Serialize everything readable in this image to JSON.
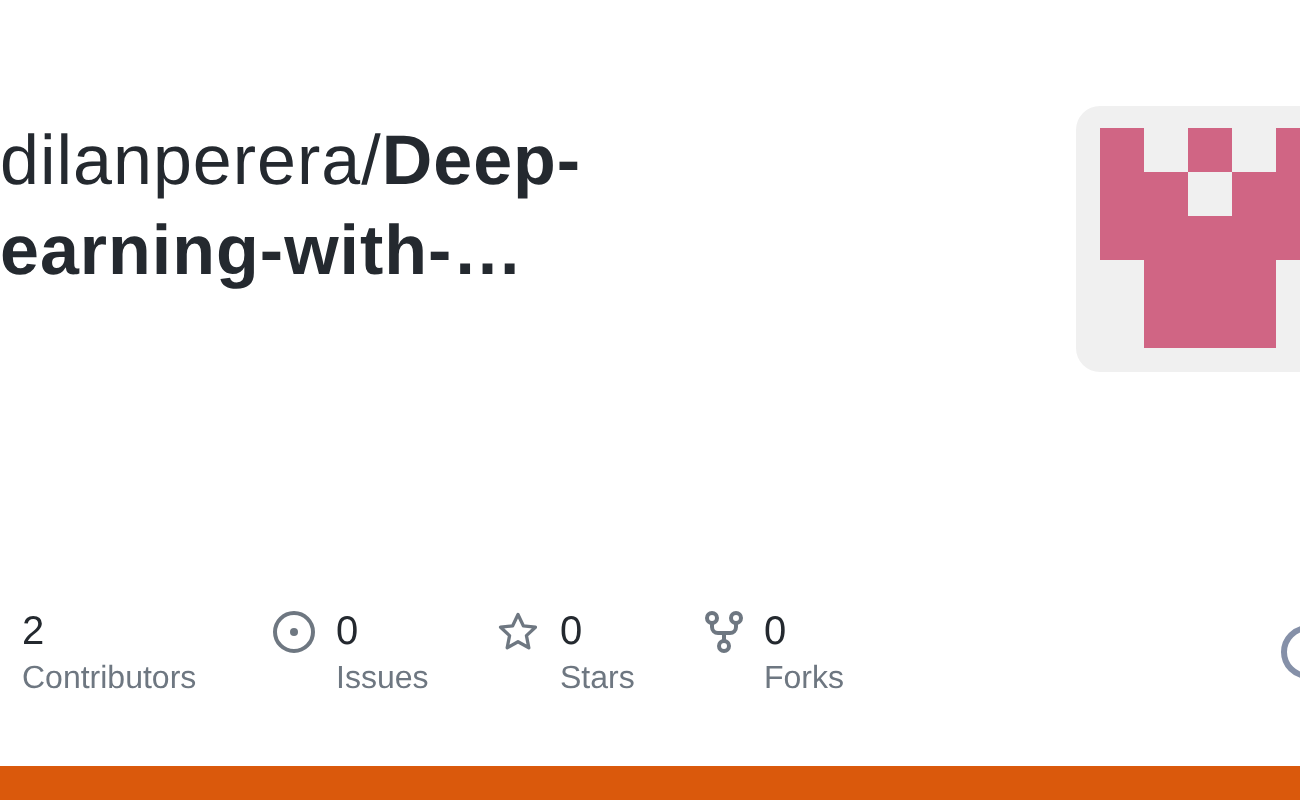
{
  "repo": {
    "owner": "dilanperera/",
    "name_line_1": "Deep-",
    "name_line_2": "earning-with-…"
  },
  "stats": [
    {
      "kind": "contributors",
      "value": "2",
      "label": "Contributors"
    },
    {
      "kind": "issues",
      "value": "0",
      "label": "Issues"
    },
    {
      "kind": "stars",
      "value": "0",
      "label": "Stars"
    },
    {
      "kind": "forks",
      "value": "0",
      "label": "Forks"
    }
  ]
}
